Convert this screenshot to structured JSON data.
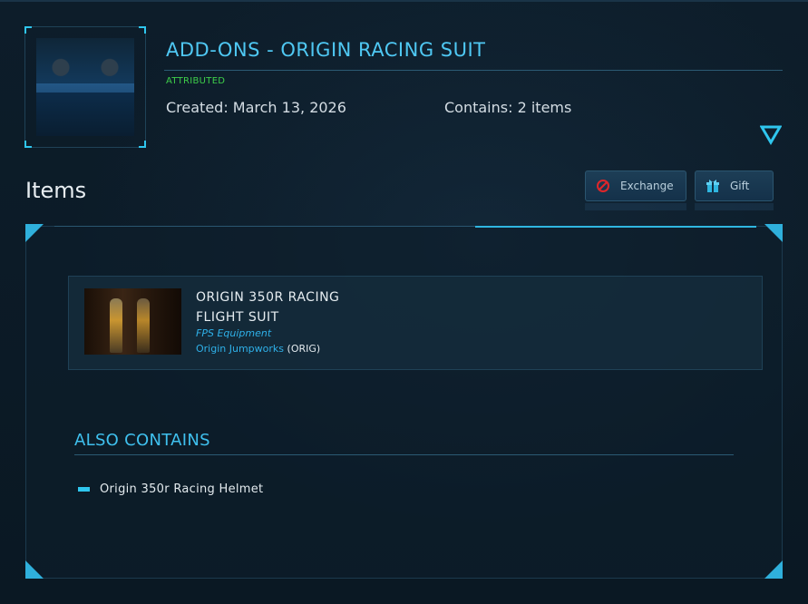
{
  "header": {
    "title": "ADD-ONS - ORIGIN RACING SUIT",
    "status_badge": "ATTRIBUTED",
    "created": "Created: March 13, 2026",
    "contains": "Contains: 2 items"
  },
  "items_section": {
    "heading": "Items",
    "actions": {
      "exchange_label": "Exchange",
      "gift_label": "Gift"
    }
  },
  "item_card": {
    "name_line1": "ORIGIN 350R RACING",
    "name_line2": "FLIGHT SUIT",
    "category": "FPS Equipment",
    "manufacturer": "Origin Jumpworks",
    "manufacturer_code": "ORIG"
  },
  "also_contains": {
    "heading": "ALSO CONTAINS",
    "items": [
      {
        "label": "Origin 350r Racing Helmet"
      }
    ]
  },
  "colors": {
    "accent": "#4fc8f3",
    "status_green": "#3ecf4a",
    "background": "#0b1a26"
  },
  "icons": {
    "expand": "triangle-down-icon",
    "exchange": "prohibited-icon",
    "gift": "gift-box-icon"
  }
}
